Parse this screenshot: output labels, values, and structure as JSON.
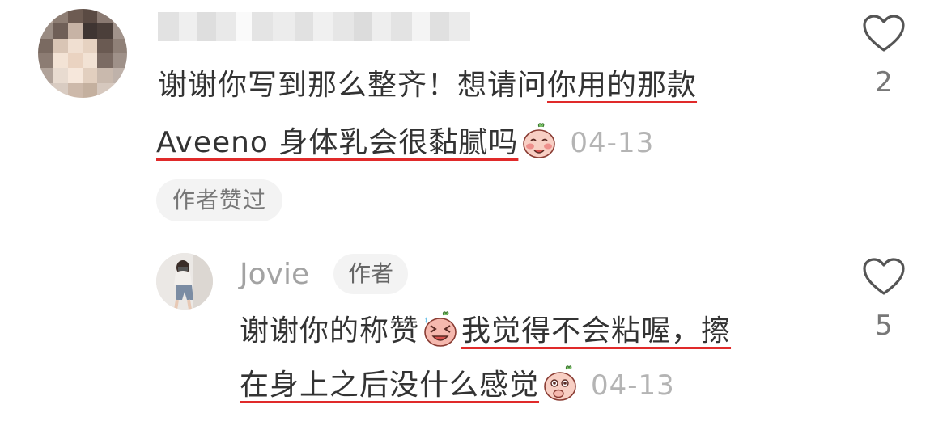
{
  "comment": {
    "text_line1_a": "谢谢你写到那么整齐！想请问",
    "text_line1_b": "你用的那款",
    "text_line2": "Aveeno 身体乳会很黏腻吗",
    "date": "04-13",
    "liked_by_author": "作者赞过",
    "like_count": "2",
    "emoji": "shy-peach-emoji"
  },
  "reply": {
    "username": "Jovie",
    "author_badge": "作者",
    "text_line1_a": "谢谢你的称赞",
    "text_line1_b": "我觉得不会粘喔，擦",
    "text_line2": "在身上之后没什么感觉",
    "date": "04-13",
    "like_count": "5",
    "emoji1": "laughing-peach-emoji",
    "emoji2": "thinking-peach-emoji"
  },
  "colors": {
    "underline": "#e02a2a",
    "date": "#b4b4b4",
    "chip_bg": "#f3f3f3"
  }
}
